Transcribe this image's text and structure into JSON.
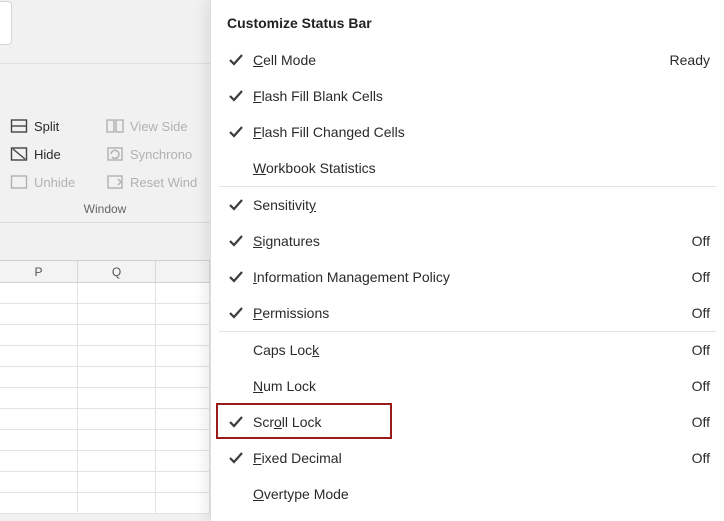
{
  "ribbon": {
    "group_label": "Window",
    "left_column": [
      {
        "label": "Split",
        "enabled": true,
        "icon": "split"
      },
      {
        "label": "Hide",
        "enabled": true,
        "icon": "hide"
      },
      {
        "label": "Unhide",
        "enabled": false,
        "icon": "unhide"
      }
    ],
    "right_column": [
      {
        "label": "View Side",
        "enabled": false,
        "icon": "viewside"
      },
      {
        "label": "Synchrono",
        "enabled": false,
        "icon": "sync"
      },
      {
        "label": "Reset Wind",
        "enabled": false,
        "icon": "resetwin"
      }
    ]
  },
  "sheet": {
    "columns": [
      "P",
      "Q"
    ]
  },
  "popup": {
    "title": "Customize Status Bar",
    "groups": [
      [
        {
          "checked": true,
          "label": "Cell Mode",
          "ul": 0,
          "value": "Ready"
        },
        {
          "checked": true,
          "label": "Flash Fill Blank Cells",
          "ul": 0
        },
        {
          "checked": true,
          "label": "Flash Fill Changed Cells",
          "ul": 0
        },
        {
          "checked": false,
          "label": "Workbook Statistics",
          "ul": 0
        }
      ],
      [
        {
          "checked": true,
          "label": "Sensitivity",
          "ul": 10
        },
        {
          "checked": true,
          "label": "Signatures",
          "ul": 0,
          "value": "Off"
        },
        {
          "checked": true,
          "label": "Information Management Policy",
          "ul": 0,
          "value": "Off"
        },
        {
          "checked": true,
          "label": "Permissions",
          "ul": 0,
          "value": "Off"
        }
      ],
      [
        {
          "checked": false,
          "label": "Caps Lock",
          "ul": 8,
          "value": "Off"
        },
        {
          "checked": false,
          "label": "Num Lock",
          "ul": 0,
          "value": "Off"
        },
        {
          "checked": true,
          "label": "Scroll Lock",
          "ul": 3,
          "value": "Off",
          "highlight": true
        },
        {
          "checked": true,
          "label": "Fixed Decimal",
          "ul": 0,
          "value": "Off"
        },
        {
          "checked": false,
          "label": "Overtype Mode",
          "ul": 0
        }
      ]
    ]
  }
}
